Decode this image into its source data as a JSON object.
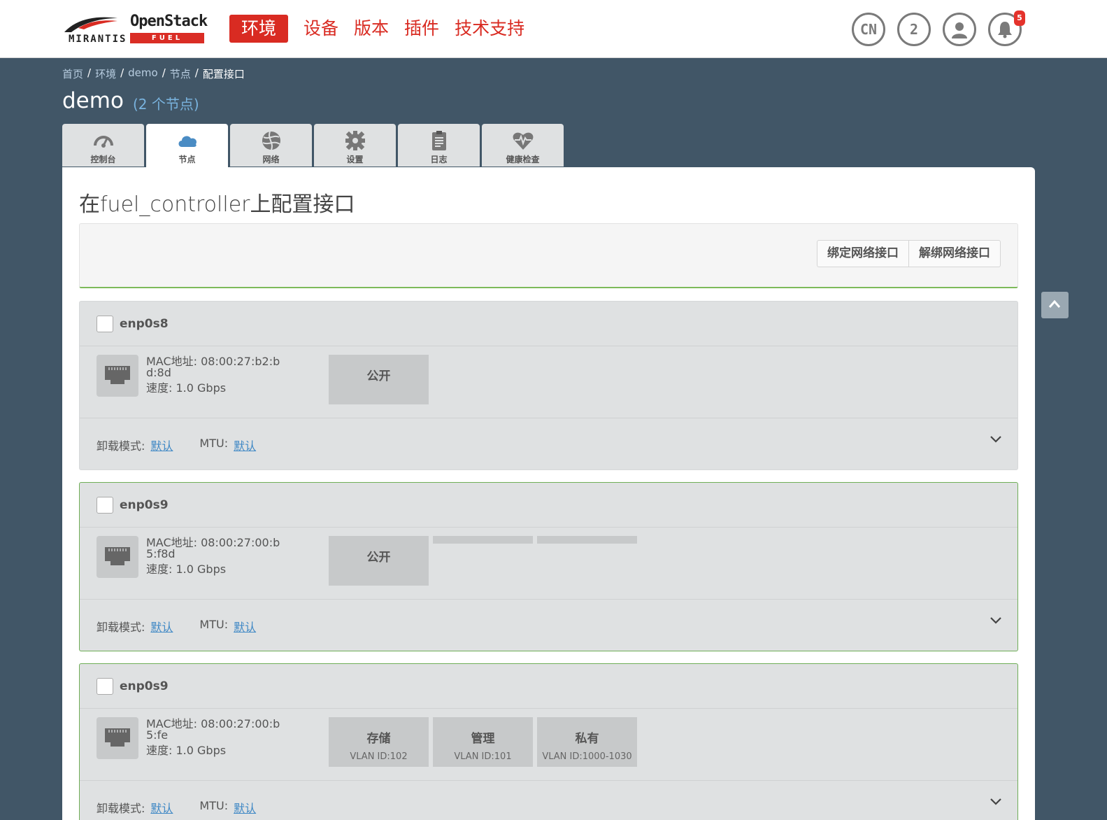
{
  "header": {
    "logo_brand": "MIRANTIS",
    "logo_product": "OpenStack",
    "logo_sub": "FUEL",
    "nav": [
      {
        "label": "环境",
        "active": true
      },
      {
        "label": "设备",
        "active": false
      },
      {
        "label": "版本",
        "active": false
      },
      {
        "label": "插件",
        "active": false
      },
      {
        "label": "技术支持",
        "active": false
      }
    ],
    "lang": "CN",
    "node_count": "2",
    "notifications": "5"
  },
  "breadcrumb": [
    "首页",
    "环境",
    "demo",
    "节点",
    "配置接口"
  ],
  "env": {
    "title": "demo",
    "subtitle": "(2 个节点)"
  },
  "tabs": [
    {
      "label": "控制台",
      "icon": "dashboard-icon"
    },
    {
      "label": "节点",
      "icon": "cloud-icon",
      "active": true
    },
    {
      "label": "网络",
      "icon": "network-icon"
    },
    {
      "label": "设置",
      "icon": "gear-icon"
    },
    {
      "label": "日志",
      "icon": "clipboard-icon"
    },
    {
      "label": "健康检查",
      "icon": "heartbeat-icon"
    }
  ],
  "page": {
    "title": "在fuel_controller上配置接口",
    "bond_label": "绑定网络接口",
    "unbond_label": "解绑网络接口"
  },
  "interfaces": [
    {
      "name": "enp0s8",
      "mac": "MAC地址: 08:00:27:b2:bd:8d",
      "speed": "速度: 1.0 Gbps",
      "networks": [
        {
          "name": "公开",
          "vlan": ""
        }
      ],
      "offload_label": "卸载模式:",
      "offload_value": "默认",
      "mtu_label": "MTU:",
      "mtu_value": "默认"
    },
    {
      "name": "enp0s9",
      "mac": "MAC地址: 08:00:27:00:b5:f8d",
      "speed": "速度: 1.0 Gbps",
      "networks": [
        {
          "name": "公开",
          "vlan": ""
        }
      ],
      "offload_label": "卸载模式:",
      "offload_value": "默认",
      "mtu_label": "MTU:",
      "mtu_value": "默认"
    },
    {
      "name": "enp0s9",
      "mac": "MAC地址: 08:00:27:00:b5:fe",
      "speed": "速度: 1.0 Gbps",
      "networks": [
        {
          "name": "存储",
          "vlan": "VLAN ID:102"
        },
        {
          "name": "管理",
          "vlan": "VLAN ID:101"
        },
        {
          "name": "私有",
          "vlan": "VLAN ID:1000-1030"
        }
      ],
      "offload_label": "卸载模式:",
      "offload_value": "默认",
      "mtu_label": "MTU:",
      "mtu_value": "默认"
    }
  ],
  "colors": {
    "brand_red": "#d92b22",
    "background": "#415667",
    "link": "#3f88c5",
    "accent_green": "#6fae57"
  }
}
